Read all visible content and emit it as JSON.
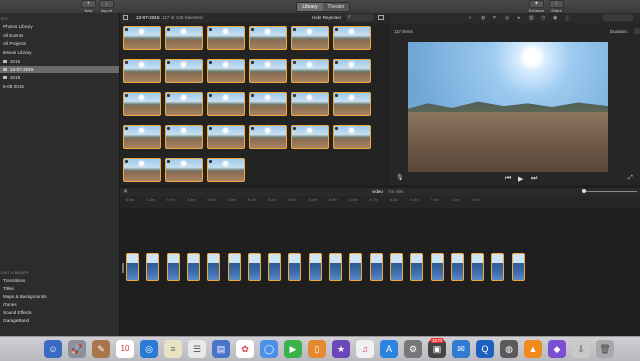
{
  "toolbar": {
    "new_label": "New",
    "import_label": "Import",
    "library_label": "Library",
    "theater_label": "Theater",
    "enhance_label": "Enhance",
    "share_label": "Share"
  },
  "sidebar": {
    "libraries_heading": "IES",
    "items": [
      {
        "label": "Photos Library",
        "selected": false
      },
      {
        "label": "All Events",
        "selected": false
      },
      {
        "label": "All Projects",
        "selected": false
      },
      {
        "label": "iMovie Library",
        "selected": false
      },
      {
        "label": "2015",
        "selected": false
      },
      {
        "label": "13-07-2015",
        "selected": true
      },
      {
        "label": "2018",
        "selected": false
      },
      {
        "label": "5-08-2015",
        "selected": false
      }
    ],
    "content_heading": "ENT LIBRARY",
    "content_items": [
      {
        "label": "Transitions"
      },
      {
        "label": "Titles"
      },
      {
        "label": "Maps & Backgrounds"
      },
      {
        "label": "iTunes"
      },
      {
        "label": "Sound Effects"
      },
      {
        "label": "GarageBand"
      }
    ]
  },
  "browser": {
    "date": "13-07-2015",
    "selection": "117 of 146 Selected",
    "filter": "Hide Rejected"
  },
  "viewer": {
    "items_count": "117 items",
    "duration_label": "Duration:"
  },
  "timeline": {
    "label": "video",
    "duration": "7m 49s",
    "ticks": [
      "5.5m",
      "5.6m",
      "5.7m",
      "5.8m",
      "5.9m",
      "6.0m",
      "6.1m",
      "6.2m",
      "6.3m",
      "6.4m",
      "6.5m",
      "6.6m",
      "6.7m",
      "6.8m",
      "6.9m",
      "7.0m",
      "7.1m",
      "7.2m"
    ]
  },
  "dock": {
    "calendar_day": "10",
    "badge_count": "3570"
  },
  "colors": {
    "accent": "#f2a93b",
    "selected_row": "#6b6b6b"
  }
}
